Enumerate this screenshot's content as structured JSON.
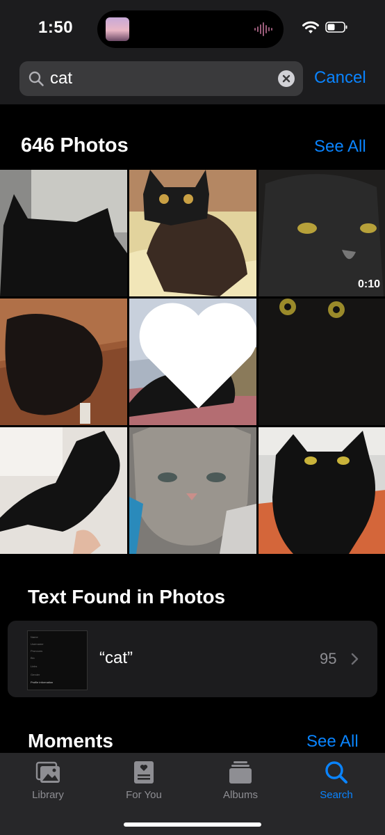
{
  "status_bar": {
    "time": "1:50"
  },
  "search": {
    "query": "cat",
    "cancel_label": "Cancel"
  },
  "photos_section": {
    "title": "646 Photos",
    "see_all_label": "See All",
    "items": [
      {
        "subject": "black cat from behind on grey couch"
      },
      {
        "subject": "cat wearing batman mask"
      },
      {
        "subject": "black cat close-up",
        "video_duration": "0:10"
      },
      {
        "subject": "black cat on patterned blanket"
      },
      {
        "subject": "black cat lounging under sky",
        "favorite": true
      },
      {
        "subject": "black cat face close-up"
      },
      {
        "subject": "black cat stretched on rug"
      },
      {
        "subject": "grey tabby cat close-up"
      },
      {
        "subject": "black cat on orange blanket"
      }
    ]
  },
  "text_found": {
    "title": "Text Found in Photos",
    "query_label": "“cat”",
    "count": "95",
    "thumb_rows": [
      "Name",
      "Username",
      "Pronouns",
      "Bio",
      "Links",
      "Gender",
      "Profile information"
    ]
  },
  "moments": {
    "title": "Moments",
    "see_all_label": "See All"
  },
  "tab_bar": [
    {
      "label": "Library",
      "icon": "library-icon"
    },
    {
      "label": "For You",
      "icon": "for-you-icon"
    },
    {
      "label": "Albums",
      "icon": "albums-icon"
    },
    {
      "label": "Search",
      "icon": "search-tab-icon",
      "active": true
    }
  ],
  "colors": {
    "accent": "#0a84ff",
    "background": "#000000",
    "card": "#1c1c1e"
  }
}
